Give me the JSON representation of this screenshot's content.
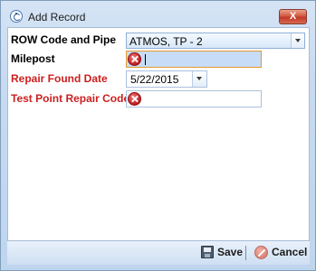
{
  "window": {
    "title": "Add Record",
    "close_label": "X"
  },
  "form": {
    "row_code": {
      "label": "ROW Code and Pipe",
      "value": "ATMOS, TP - 2"
    },
    "milepost": {
      "label": "Milepost",
      "value": ""
    },
    "repair_found_date": {
      "label": "Repair Found Date",
      "value": "5/22/2015"
    },
    "test_point_repair_code": {
      "label": "Test Point Repair Code",
      "value": ""
    }
  },
  "footer": {
    "save_label": "Save",
    "cancel_label": "Cancel"
  },
  "colors": {
    "required_label": "#cc1f1f",
    "focused_border": "#e69a2e",
    "focused_fill": "#c6dcf7"
  },
  "icons": {
    "app": "app-compass-icon",
    "validation": "error-icon",
    "save": "floppy-disk-icon",
    "cancel": "cancel-icon"
  }
}
